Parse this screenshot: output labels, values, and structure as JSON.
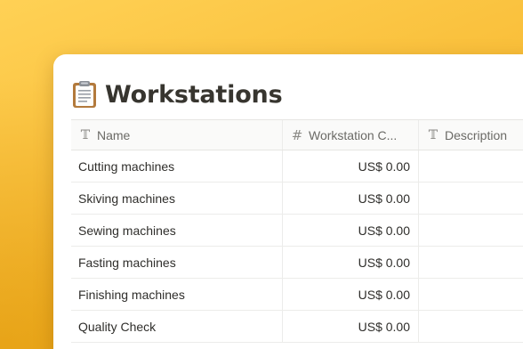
{
  "page": {
    "icon": "clipboard-icon",
    "title": "Workstations"
  },
  "table": {
    "columns": [
      {
        "label": "Name",
        "icon": "text-type-icon",
        "glyph": "𝕋"
      },
      {
        "label": "Workstation C...",
        "icon": "number-type-icon",
        "glyph": "#"
      },
      {
        "label": "Description",
        "icon": "text-type-icon",
        "glyph": "𝕋"
      }
    ],
    "rows": [
      {
        "name": "Cutting machines",
        "cost": "US$ 0.00",
        "description": ""
      },
      {
        "name": "Skiving machines",
        "cost": "US$ 0.00",
        "description": ""
      },
      {
        "name": "Sewing machines",
        "cost": "US$ 0.00",
        "description": ""
      },
      {
        "name": "Fasting machines",
        "cost": "US$ 0.00",
        "description": ""
      },
      {
        "name": "Finishing machines",
        "cost": "US$ 0.00",
        "description": ""
      },
      {
        "name": "Quality Check",
        "cost": "US$ 0.00",
        "description": ""
      }
    ]
  },
  "colors": {
    "background": "#F9BF3A",
    "panel": "#ffffff",
    "text": "#37352f"
  }
}
